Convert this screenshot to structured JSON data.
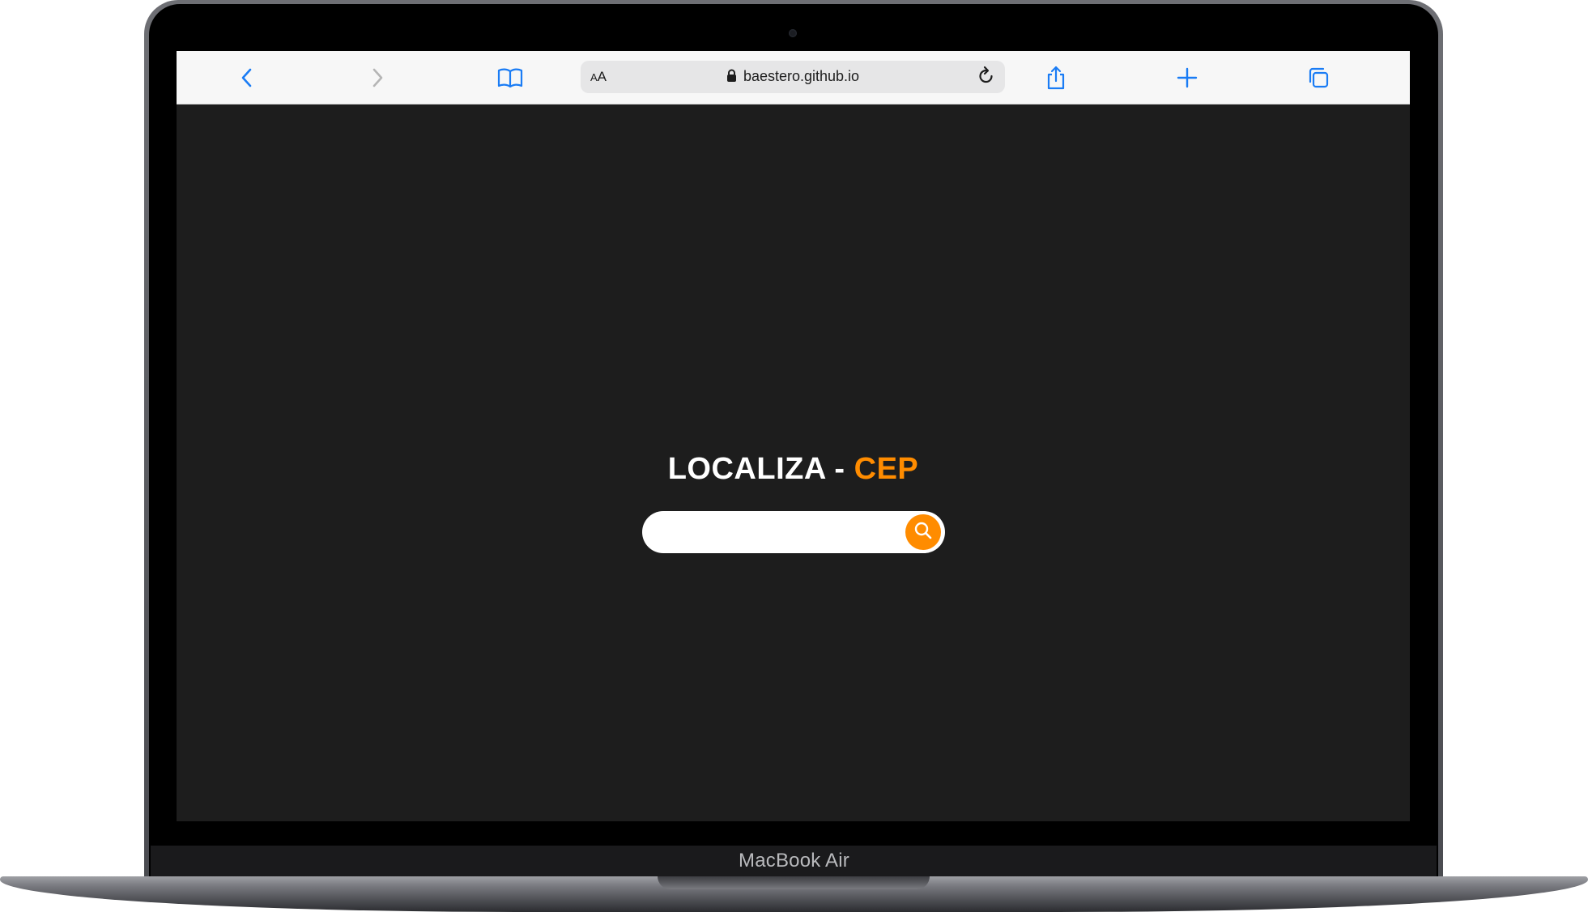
{
  "device": {
    "label": "MacBook Air"
  },
  "browser": {
    "address_bar": {
      "reader_label_small": "A",
      "reader_label_large": "A",
      "url": "baestero.github.io"
    },
    "icons": {
      "back": "chevron-left-icon",
      "forward": "chevron-right-icon",
      "bookmarks": "book-icon",
      "lock": "lock-icon",
      "reload": "reload-icon",
      "share": "share-icon",
      "new_tab": "plus-icon",
      "tabs": "tabs-icon"
    },
    "colors": {
      "accent": "#1a7cf5",
      "disabled": "#b5b5b5",
      "toolbar_bg": "#f7f7f7"
    }
  },
  "page": {
    "title_main": "LOCALIZA - ",
    "title_accent": "CEP",
    "search": {
      "placeholder": "",
      "value": ""
    },
    "icons": {
      "search": "search-icon"
    },
    "colors": {
      "background": "#1d1d1d",
      "accent": "#ff8c00",
      "text": "#ffffff"
    }
  }
}
